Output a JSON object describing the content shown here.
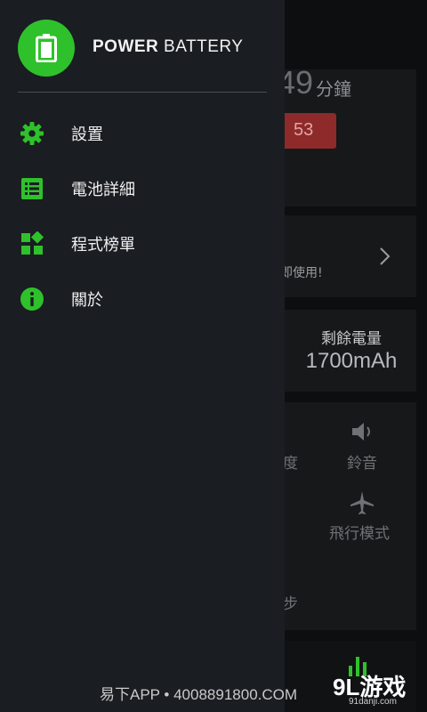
{
  "background_app": {
    "time_value": "49",
    "time_unit": "分鐘",
    "red_badge_value": "53",
    "promo_text": "即使用!",
    "remaining_label": "剩餘電量",
    "remaining_value": "1700mAh",
    "toggle_brightness_label": "度",
    "toggle_ringtone_label": "鈴音",
    "toggle_airplane_label": "飛行模式",
    "toggle_sync_label": "步"
  },
  "drawer": {
    "app_title_bold": "POWER",
    "app_title_rest": " BATTERY",
    "items": [
      {
        "label": "設置",
        "icon": "gear-icon"
      },
      {
        "label": "電池詳細",
        "icon": "list-icon"
      },
      {
        "label": "程式榜單",
        "icon": "widgets-icon"
      },
      {
        "label": "關於",
        "icon": "info-icon"
      }
    ]
  },
  "watermark": {
    "left_text": "易下APP • 4008891800.COM",
    "logo_text": "9L游戏",
    "url_text": "91danji.com"
  },
  "colors": {
    "accent_green": "#2fc12b",
    "drawer_bg": "#1a1d22",
    "badge_red": "#8f2a2a"
  }
}
